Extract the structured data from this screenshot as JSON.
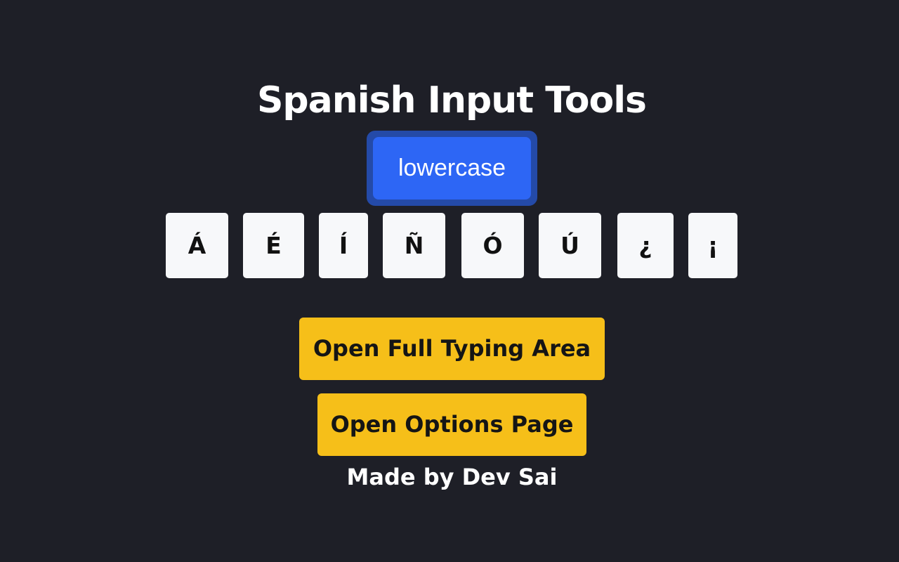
{
  "title": "Spanish Input Tools",
  "case_toggle": "lowercase",
  "keys": [
    "Á",
    "É",
    "Í",
    "Ñ",
    "Ó",
    "Ú",
    "¿",
    "¡"
  ],
  "buttons": {
    "full_typing": "Open Full Typing Area",
    "options": "Open Options Page"
  },
  "credit": "Made by Dev Sai",
  "colors": {
    "background": "#1e1f27",
    "accent_blue": "#2d66f5",
    "accent_blue_border": "#244aa8",
    "accent_yellow": "#f6bf19",
    "key_background": "#f7f8fa"
  }
}
